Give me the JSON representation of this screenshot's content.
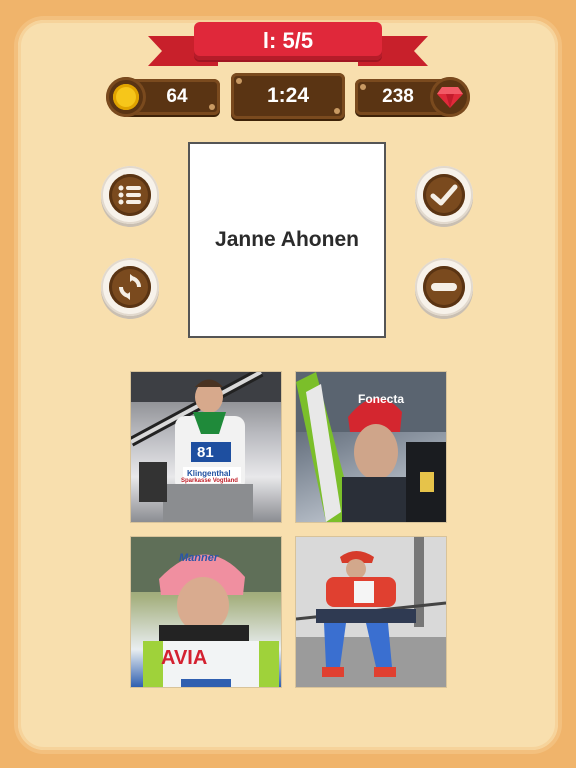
{
  "level": {
    "label": "l: 5/5"
  },
  "stats": {
    "coins": "64",
    "timer": "1:24",
    "gems": "238"
  },
  "card": {
    "word": "Janne Ahonen"
  },
  "buttons": {
    "list": "list-icon",
    "refresh": "refresh-icon",
    "check": "check-icon",
    "remove": "minus-icon"
  },
  "photos": [
    {
      "bib": "81",
      "sponsor": "Klingenthal",
      "sponsor2": "Sparkasse Vogtland"
    },
    {
      "helmet": "Fonecta"
    },
    {
      "helmet": "Manner",
      "bib": "AVIA"
    },
    {}
  ],
  "colors": {
    "ribbon": "#e0283a",
    "wood": "#5a3413",
    "coin": "#f6c61a",
    "gem": "#e02a3a",
    "panel": "#f8dfae"
  }
}
